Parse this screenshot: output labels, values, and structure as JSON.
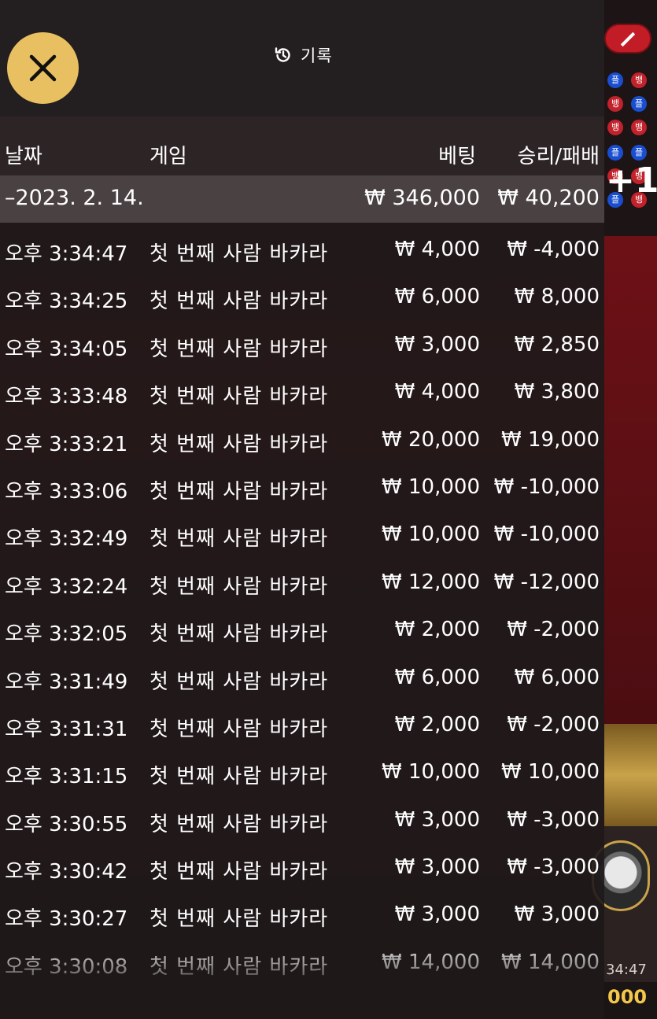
{
  "header": {
    "close_icon": "close-icon",
    "history_icon": "history-clock-icon",
    "title": "기록"
  },
  "columns": {
    "date": "날짜",
    "game": "게임",
    "bet": "베팅",
    "win_loss": "승리/패배"
  },
  "day_summary": {
    "date": "–2023. 2. 14.",
    "bet": "₩ 346,000",
    "win_loss": "₩ 40,200"
  },
  "rows": [
    {
      "time": "오후 3:34:47",
      "game": "첫 번째 사람 바카라",
      "bet": "₩ 4,000",
      "win_loss": "₩ -4,000"
    },
    {
      "time": "오후 3:34:25",
      "game": "첫 번째 사람 바카라",
      "bet": "₩ 6,000",
      "win_loss": "₩ 8,000"
    },
    {
      "time": "오후 3:34:05",
      "game": "첫 번째 사람 바카라",
      "bet": "₩ 3,000",
      "win_loss": "₩ 2,850"
    },
    {
      "time": "오후 3:33:48",
      "game": "첫 번째 사람 바카라",
      "bet": "₩ 4,000",
      "win_loss": "₩ 3,800"
    },
    {
      "time": "오후 3:33:21",
      "game": "첫 번째 사람 바카라",
      "bet": "₩ 20,000",
      "win_loss": "₩ 19,000"
    },
    {
      "time": "오후 3:33:06",
      "game": "첫 번째 사람 바카라",
      "bet": "₩ 10,000",
      "win_loss": "₩ -10,000"
    },
    {
      "time": "오후 3:32:49",
      "game": "첫 번째 사람 바카라",
      "bet": "₩ 10,000",
      "win_loss": "₩ -10,000"
    },
    {
      "time": "오후 3:32:24",
      "game": "첫 번째 사람 바카라",
      "bet": "₩ 12,000",
      "win_loss": "₩ -12,000"
    },
    {
      "time": "오후 3:32:05",
      "game": "첫 번째 사람 바카라",
      "bet": "₩ 2,000",
      "win_loss": "₩ -2,000"
    },
    {
      "time": "오후 3:31:49",
      "game": "첫 번째 사람 바카라",
      "bet": "₩ 6,000",
      "win_loss": "₩ 6,000"
    },
    {
      "time": "오후 3:31:31",
      "game": "첫 번째 사람 바카라",
      "bet": "₩ 2,000",
      "win_loss": "₩ -2,000"
    },
    {
      "time": "오후 3:31:15",
      "game": "첫 번째 사람 바카라",
      "bet": "₩ 10,000",
      "win_loss": "₩ 10,000"
    },
    {
      "time": "오후 3:30:55",
      "game": "첫 번째 사람 바카라",
      "bet": "₩ 3,000",
      "win_loss": "₩ -3,000"
    },
    {
      "time": "오후 3:30:42",
      "game": "첫 번째 사람 바카라",
      "bet": "₩ 3,000",
      "win_loss": "₩ -3,000"
    },
    {
      "time": "오후 3:30:27",
      "game": "첫 번째 사람 바카라",
      "bet": "₩ 3,000",
      "win_loss": "₩ 3,000"
    },
    {
      "time": "오후 3:30:08",
      "game": "첫 번째 사람 바카라",
      "bet": "₩ 14,000",
      "win_loss": "₩ 14,000"
    }
  ],
  "background": {
    "road_labels": [
      "플",
      "뱅",
      "뱅",
      "플",
      "뱅",
      "뱅",
      "플",
      "플",
      "뱅",
      "뱅",
      "플",
      "뱅"
    ],
    "plus_badge": "+1",
    "clock_fragment": "34:47",
    "balance_fragment": "000"
  },
  "colors": {
    "close_button": "#e9c061",
    "panel": "#1e1819",
    "day_row": "#4a4142",
    "text": "#ffffff"
  }
}
